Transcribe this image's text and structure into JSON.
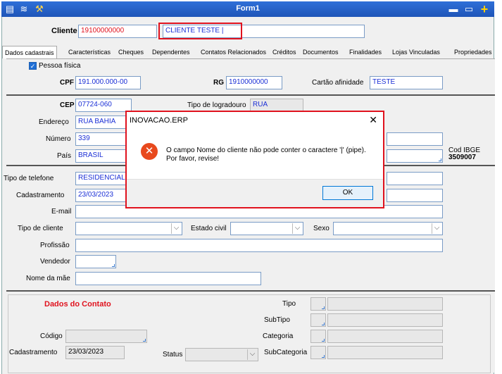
{
  "window": {
    "title": "Form1"
  },
  "header": {
    "cliente_label": "Cliente",
    "cliente_code": "19100000000",
    "cliente_name": "CLIENTE TESTE |"
  },
  "tabs": [
    "Dados cadastrais",
    "Características",
    "Cheques",
    "Dependentes",
    "Contatos Relacionados",
    "Créditos",
    "Documentos",
    "Finalidades",
    "Lojas Vinculadas",
    "Propriedades"
  ],
  "form": {
    "pessoa_fisica": "Pessoa física",
    "cpf_label": "CPF",
    "cpf": "191.000.000-00",
    "rg_label": "RG",
    "rg": "1910000000",
    "cartao_label": "Cartão afinidade",
    "cartao": "TESTE",
    "cep_label": "CEP",
    "cep": "07724-060",
    "tipo_logradouro_label": "Tipo de logradouro",
    "tipo_logradouro": "RUA",
    "endereco_label": "Endereço",
    "endereco": "RUA BAHIA",
    "numero_label": "Número",
    "numero": "339",
    "pais_label": "País",
    "pais": "BRASIL",
    "cod_ibge_label": "Cod IBGE",
    "cod_ibge": "3509007",
    "tipo_telefone_label": "Tipo de telefone",
    "tipo_telefone": "RESIDENCIAL",
    "cadastramento_label": "Cadastramento",
    "cadastramento": "23/03/2023",
    "email_label": "E-mail",
    "tipo_cliente_label": "Tipo de cliente",
    "estado_civil_label": "Estado civil",
    "sexo_label": "Sexo",
    "profissao_label": "Profissão",
    "vendedor_label": "Vendedor",
    "nome_mae_label": "Nome da mãe"
  },
  "contato": {
    "title": "Dados do Contato",
    "codigo_label": "Código",
    "cadastramento_label": "Cadastramento",
    "cadastramento": "23/03/2023",
    "status_label": "Status",
    "tipo_label": "Tipo",
    "subtipo_label": "SubTipo",
    "categoria_label": "Categoria",
    "subcategoria_label": "SubCategoria"
  },
  "dialog": {
    "title": "INOVACAO.ERP",
    "close": "✕",
    "message": "O campo Nome do cliente não pode conter o caractere '|' (pipe). Por favor, revise!",
    "ok_label": "OK"
  },
  "colors": {
    "titlebar": "#1f55b8",
    "highlight": "#e0121e",
    "input_text": "#1b2fd6"
  }
}
